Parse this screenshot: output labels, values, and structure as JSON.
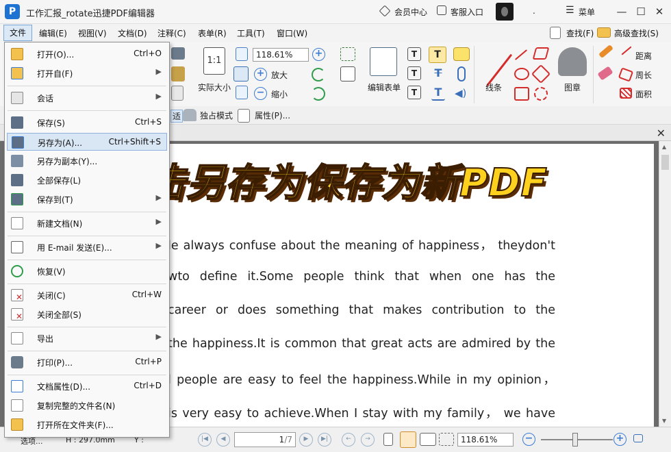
{
  "titlebar": {
    "app_logo": "P",
    "title": "工作汇报_rotate迅捷PDF编辑器",
    "member_center": "会员中心",
    "customer_service": "客服入口",
    "dot": ".",
    "menu_label": "菜单"
  },
  "menubar": {
    "items": [
      "文件",
      "编辑(E)",
      "视图(V)",
      "文档(D)",
      "注释(C)",
      "表单(R)",
      "工具(T)",
      "窗口(W)"
    ],
    "search": "查找(F)",
    "advanced_search": "高级查找(S)"
  },
  "toolbar": {
    "zoom_value": "118.61%",
    "actual_size": "实际大小",
    "zoom_in": "放大",
    "zoom_out": "缩小",
    "edit_form": "编辑表单",
    "line_label": "线条",
    "stamp_label": "图章",
    "distance": "距离",
    "perimeter": "周长",
    "area": "面积",
    "fit_partial": "适",
    "exclusive_mode": "独占模式",
    "properties": "属性(P)..."
  },
  "file_menu": {
    "items": [
      {
        "label": "打开(O)...",
        "shortcut": "Ctrl+O",
        "arrow": false
      },
      {
        "label": "打开自(F)",
        "shortcut": "",
        "arrow": true
      },
      {
        "label": "会话",
        "shortcut": "",
        "arrow": true
      },
      {
        "label": "保存(S)",
        "shortcut": "Ctrl+S",
        "arrow": false
      },
      {
        "label": "另存为(A)...",
        "shortcut": "Ctrl+Shift+S",
        "arrow": false,
        "highlighted": true
      },
      {
        "label": "另存为副本(Y)...",
        "shortcut": "",
        "arrow": false
      },
      {
        "label": "全部保存(L)",
        "shortcut": "",
        "arrow": false
      },
      {
        "label": "保存到(T)",
        "shortcut": "",
        "arrow": true
      },
      {
        "label": "新建文档(N)",
        "shortcut": "",
        "arrow": true
      },
      {
        "label": "用 E-mail 发送(E)...",
        "shortcut": "",
        "arrow": true
      },
      {
        "label": "恢复(V)",
        "shortcut": "",
        "arrow": false
      },
      {
        "label": "关闭(C)",
        "shortcut": "Ctrl+W",
        "arrow": false
      },
      {
        "label": "关闭全部(S)",
        "shortcut": "",
        "arrow": false
      },
      {
        "label": "导出",
        "shortcut": "",
        "arrow": true
      },
      {
        "label": "打印(P)...",
        "shortcut": "Ctrl+P",
        "arrow": false
      },
      {
        "label": "文档属性(D)...",
        "shortcut": "Ctrl+D",
        "arrow": false
      },
      {
        "label": "复制完整的文件名(N)",
        "shortcut": "",
        "arrow": false
      },
      {
        "label": "打开所在文件夹(F)...",
        "shortcut": "",
        "arrow": false
      }
    ]
  },
  "document": {
    "banner": "点击另存为保存为新PDF",
    "lines": [
      "le always confuse about the meaning of happiness， theydon't",
      "wto  define  it.Some  people  think  that  when  one  has  the",
      " career  or  does  something  that  makes  contribution  to  the",
      "the happiness.It is common that great acts are admired by the",
      "l people are easy to feel the happiness.While in my opinion，",
      " is very easy to achieve.When I stay with my family， we have"
    ]
  },
  "statusbar": {
    "left_text": "选项...",
    "height_text": "H : 297.0mm",
    "y_text": "Y :",
    "page_current": "1",
    "page_total": "/7",
    "zoom_value": "118.61%"
  },
  "colors": {
    "accent": "#1e73d2",
    "banner_fill": "#ffd11f",
    "menu_highlight": "#d9e6f4"
  }
}
